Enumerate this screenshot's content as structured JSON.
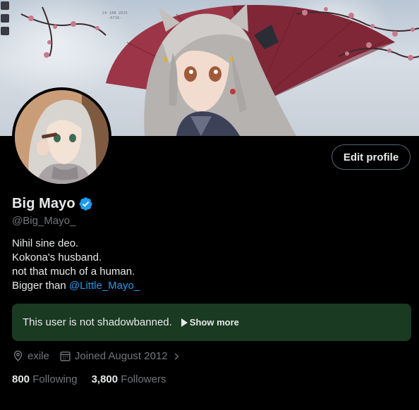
{
  "banner": {
    "date_line_1": "24 JAN 2025",
    "date_line_2": "-0736-"
  },
  "profile": {
    "display_name": "Big Mayo",
    "handle": "@Big_Mayo_",
    "edit_profile_label": "Edit profile",
    "bio_lines": [
      "Nihil sine deo.",
      "Kokona's husband.",
      "not that much of a human.",
      "Bigger than"
    ],
    "bio_mention": "@Little_Mayo_"
  },
  "shadowban": {
    "status_text": "This user is not shadowbanned.",
    "show_more_label": "Show more",
    "background_color": "#1b3a22"
  },
  "meta": {
    "location": "exile",
    "joined": "Joined August 2012"
  },
  "stats": {
    "following_count": "800",
    "following_label": "Following",
    "followers_count": "3,800",
    "followers_label": "Followers"
  },
  "colors": {
    "accent": "#1d9bf0",
    "secondary_text": "#71767b",
    "primary_text": "#e7e9ea"
  }
}
